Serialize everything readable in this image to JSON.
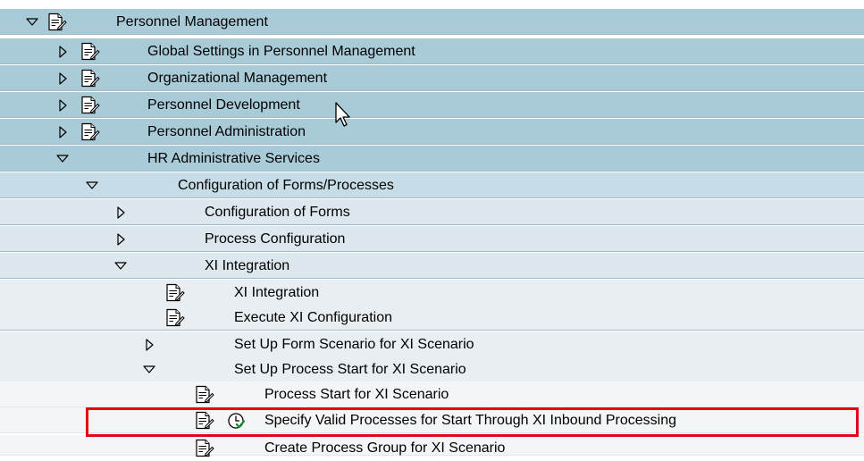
{
  "tree": {
    "items": [
      {
        "label": "Personnel Management",
        "toggle": "expanded",
        "has_doc_icon": true
      },
      {
        "label": "Global Settings in Personnel Management",
        "toggle": "collapsed",
        "has_doc_icon": true
      },
      {
        "label": "Organizational Management",
        "toggle": "collapsed",
        "has_doc_icon": true
      },
      {
        "label": "Personnel Development",
        "toggle": "collapsed",
        "has_doc_icon": true
      },
      {
        "label": "Personnel Administration",
        "toggle": "collapsed",
        "has_doc_icon": true
      },
      {
        "label": "HR Administrative Services",
        "toggle": "expanded",
        "has_doc_icon": false
      },
      {
        "label": "Configuration of Forms/Processes",
        "toggle": "expanded",
        "has_doc_icon": false
      },
      {
        "label": "Configuration of Forms",
        "toggle": "collapsed",
        "has_doc_icon": false
      },
      {
        "label": "Process Configuration",
        "toggle": "collapsed",
        "has_doc_icon": false
      },
      {
        "label": "XI Integration",
        "toggle": "expanded",
        "has_doc_icon": false
      },
      {
        "label": "XI Integration",
        "toggle": "none",
        "has_doc_icon": true
      },
      {
        "label": "Execute XI Configuration",
        "toggle": "none",
        "has_doc_icon": true
      },
      {
        "label": "Set Up Form Scenario for XI Scenario",
        "toggle": "collapsed",
        "has_doc_icon": false
      },
      {
        "label": "Set Up Process Start for XI Scenario",
        "toggle": "expanded",
        "has_doc_icon": false
      },
      {
        "label": "Process Start for XI Scenario",
        "toggle": "none",
        "has_doc_icon": true
      },
      {
        "label": "Specify Valid Processes for Start Through XI Inbound Processing",
        "toggle": "none",
        "has_doc_icon": true,
        "has_clock_icon": true,
        "highlighted": true
      },
      {
        "label": "Create Process Group for XI Scenario",
        "toggle": "none",
        "has_doc_icon": true
      }
    ]
  },
  "colors": {
    "level_0_1": "#a9cbd8",
    "level_2": "#c6dce6",
    "level_3": "#dce8ee",
    "level_4": "#e8eef1",
    "level_5": "#f3f5f6",
    "highlight_border": "#e30613"
  },
  "icons": {
    "expanded": "triangle-down-icon",
    "collapsed": "triangle-right-icon",
    "document": "document-edit-icon",
    "activity": "clock-check-icon"
  }
}
